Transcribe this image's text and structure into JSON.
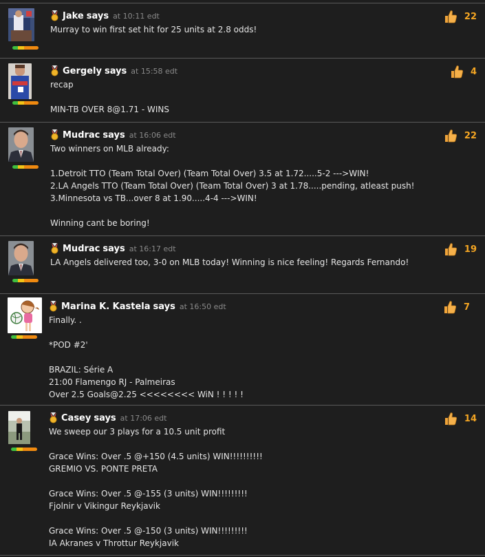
{
  "posts": [
    {
      "author": "Jake",
      "says": "says",
      "time": "at 10:11 edt",
      "likes": "22",
      "avatar": "basketball-action-photo",
      "lines": [
        "Murray to win first set hit for 25 units at 2.8 odds!"
      ]
    },
    {
      "author": "Gergely",
      "says": "says",
      "time": "at 15:58 edt",
      "likes": "4",
      "avatar": "basketball-player-photo",
      "lines": [
        "recap",
        "",
        "MIN-TB OVER 8@1.71 - WINS"
      ]
    },
    {
      "author": "Mudrac",
      "says": "says",
      "time": "at 16:06 edt",
      "likes": "22",
      "avatar": "man-in-suit-photo",
      "lines": [
        "Two winners on MLB already:",
        "",
        "1.Detroit TTO (Team Total Over) (Team Total Over) 3.5 at 1.72.....5-2 --->WIN!",
        "2.LA Angels TTO (Team Total Over) (Team Total Over) 3 at 1.78.....pending, atleast push!",
        "3.Minnesota vs TB...over 8 at 1.90.....4-4 --->WIN!",
        "",
        "Winning cant be boring!"
      ]
    },
    {
      "author": "Mudrac",
      "says": "says",
      "time": "at 16:17 edt",
      "likes": "19",
      "avatar": "man-in-suit-photo",
      "lines": [
        "LA Angels delivered too, 3-0 on MLB today! Winning is nice feeling! Regards Fernando!"
      ]
    },
    {
      "author": "Marina K. Kastela",
      "says": "says",
      "time": "at 16:50 edt",
      "likes": "7",
      "avatar": "cartoon-volleyball-girl",
      "lines": [
        "Finally. .",
        "",
        "*POD #2'",
        "",
        "BRAZIL: Série A",
        "21:00 Flamengo RJ - Palmeiras",
        "Over 2.5 Goals@2.25 <<<<<<<< WiN ! ! ! ! !"
      ]
    },
    {
      "author": "Casey",
      "says": "says",
      "time": "at 17:06 edt",
      "likes": "14",
      "avatar": "sports-court-photo",
      "lines": [
        "We sweep our 3 plays for a 10.5 unit profit",
        "",
        "Grace Wins: Over .5 @+150 (4.5 units) WIN!!!!!!!!!!",
        "GREMIO VS. PONTE PRETA",
        "",
        "Grace Wins: Over .5 @-155 (3 units) WIN!!!!!!!!!",
        "Fjolnir v Vikingur Reykjavik",
        "",
        "Grace Wins: Over .5 @-150 (3 units) WIN!!!!!!!!!",
        "IA Akranes v Throttur Reykjavik"
      ]
    }
  ],
  "colors": {
    "background": "#1e1e1e",
    "like_count": "#f5a623",
    "timestamp": "#8a8a8a",
    "divider": "#5a5a5a"
  },
  "icons": {
    "rank_badge": "medal-icon",
    "like": "thumbs-up-icon"
  }
}
